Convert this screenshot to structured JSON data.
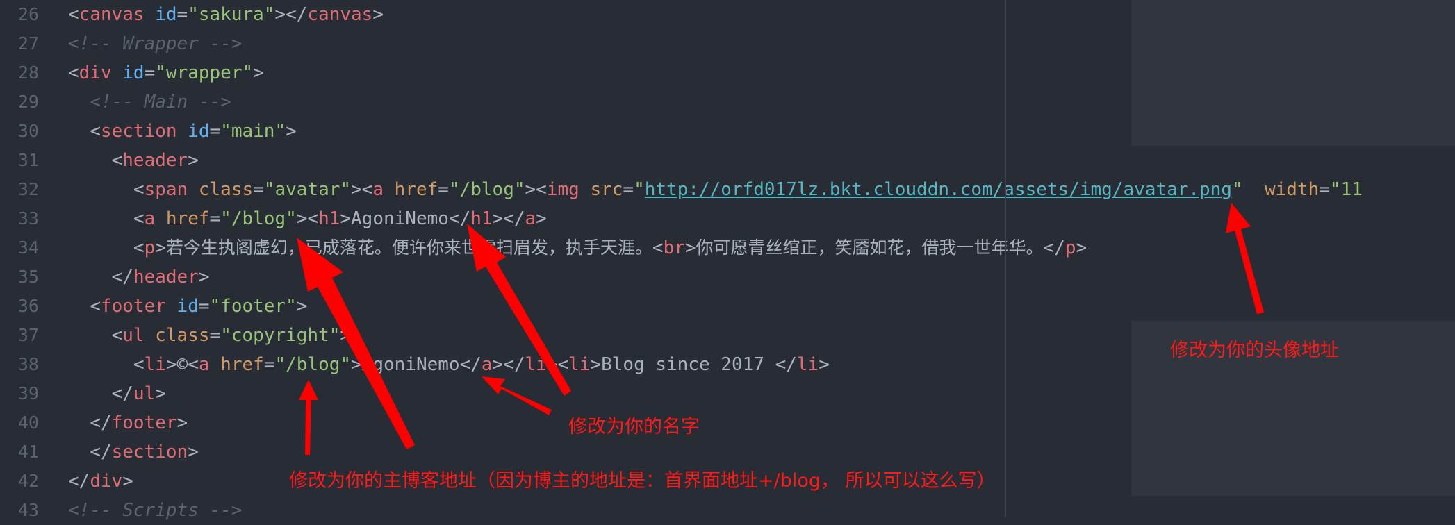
{
  "editor": {
    "lines": [
      {
        "n": "26",
        "indent": "",
        "parts": [
          [
            "punc",
            "<"
          ],
          [
            "tag",
            "canvas"
          ],
          [
            "punc",
            " "
          ],
          [
            "attr-id",
            "id"
          ],
          [
            "punc",
            "="
          ],
          [
            "str",
            "\"sakura\""
          ],
          [
            "punc",
            "></"
          ],
          [
            "tag",
            "canvas"
          ],
          [
            "punc",
            ">"
          ]
        ]
      },
      {
        "n": "27",
        "indent": "",
        "parts": [
          [
            "cmt",
            "<!-- Wrapper -->"
          ]
        ]
      },
      {
        "n": "28",
        "indent": "",
        "parts": [
          [
            "punc",
            "<"
          ],
          [
            "tag",
            "div"
          ],
          [
            "punc",
            " "
          ],
          [
            "attr-id",
            "id"
          ],
          [
            "punc",
            "="
          ],
          [
            "str",
            "\"wrapper\""
          ],
          [
            "punc",
            ">"
          ]
        ]
      },
      {
        "n": "29",
        "indent": "  ",
        "parts": [
          [
            "cmt",
            "<!-- Main -->"
          ]
        ]
      },
      {
        "n": "30",
        "indent": "  ",
        "parts": [
          [
            "punc",
            "<"
          ],
          [
            "tag",
            "section"
          ],
          [
            "punc",
            " "
          ],
          [
            "attr-id",
            "id"
          ],
          [
            "punc",
            "="
          ],
          [
            "str",
            "\"main\""
          ],
          [
            "punc",
            ">"
          ]
        ]
      },
      {
        "n": "31",
        "indent": "    ",
        "parts": [
          [
            "punc",
            "<"
          ],
          [
            "tag",
            "header"
          ],
          [
            "punc",
            ">"
          ]
        ]
      },
      {
        "n": "32",
        "indent": "      ",
        "parts": [
          [
            "punc",
            "<"
          ],
          [
            "tag",
            "span"
          ],
          [
            "punc",
            " "
          ],
          [
            "attr",
            "class"
          ],
          [
            "punc",
            "="
          ],
          [
            "str",
            "\"avatar\""
          ],
          [
            "punc",
            "><"
          ],
          [
            "tag",
            "a"
          ],
          [
            "punc",
            " "
          ],
          [
            "attr",
            "href"
          ],
          [
            "punc",
            "="
          ],
          [
            "str",
            "\"/blog\""
          ],
          [
            "punc",
            "><"
          ],
          [
            "tag",
            "img"
          ],
          [
            "punc",
            " "
          ],
          [
            "attr",
            "src"
          ],
          [
            "punc",
            "="
          ],
          [
            "str",
            "\""
          ],
          [
            "url",
            "http://orfd017lz.bkt.clouddn.com/assets/img/avatar.png"
          ],
          [
            "str",
            "\""
          ],
          [
            "punc",
            "  "
          ],
          [
            "attr",
            "width"
          ],
          [
            "punc",
            "="
          ],
          [
            "str",
            "\"11"
          ]
        ]
      },
      {
        "n": "33",
        "indent": "      ",
        "parts": [
          [
            "punc",
            "<"
          ],
          [
            "tag",
            "a"
          ],
          [
            "punc",
            " "
          ],
          [
            "attr",
            "href"
          ],
          [
            "punc",
            "="
          ],
          [
            "str",
            "\"/blog\""
          ],
          [
            "punc",
            "><"
          ],
          [
            "tag",
            "h1"
          ],
          [
            "punc",
            ">"
          ],
          [
            "txt",
            "AgoniNemo"
          ],
          [
            "punc",
            "</"
          ],
          [
            "tag",
            "h1"
          ],
          [
            "punc",
            "></"
          ],
          [
            "tag",
            "a"
          ],
          [
            "punc",
            ">"
          ]
        ]
      },
      {
        "n": "34",
        "indent": "      ",
        "parts": [
          [
            "punc",
            "<"
          ],
          [
            "tag",
            "p"
          ],
          [
            "punc",
            ">"
          ],
          [
            "txt cjk",
            "若今生执阁虚幻，已成落花。便许你来世雪扫眉发，执手天涯。"
          ],
          [
            "punc",
            "<"
          ],
          [
            "tag",
            "br"
          ],
          [
            "punc",
            ">"
          ],
          [
            "txt cjk",
            "你可愿青丝绾正，笑靥如花，借我一世年华。"
          ],
          [
            "punc",
            "</"
          ],
          [
            "tag",
            "p"
          ],
          [
            "punc",
            ">"
          ]
        ]
      },
      {
        "n": "35",
        "indent": "    ",
        "parts": [
          [
            "punc",
            "</"
          ],
          [
            "tag",
            "header"
          ],
          [
            "punc",
            ">"
          ]
        ]
      },
      {
        "n": "36",
        "indent": "  ",
        "parts": [
          [
            "punc",
            "<"
          ],
          [
            "tag",
            "footer"
          ],
          [
            "punc",
            " "
          ],
          [
            "attr-id",
            "id"
          ],
          [
            "punc",
            "="
          ],
          [
            "str",
            "\"footer\""
          ],
          [
            "punc",
            ">"
          ]
        ]
      },
      {
        "n": "37",
        "indent": "    ",
        "parts": [
          [
            "punc",
            "<"
          ],
          [
            "tag",
            "ul"
          ],
          [
            "punc",
            " "
          ],
          [
            "attr",
            "class"
          ],
          [
            "punc",
            "="
          ],
          [
            "str",
            "\"copyright\""
          ],
          [
            "punc",
            ">"
          ]
        ]
      },
      {
        "n": "38",
        "indent": "      ",
        "parts": [
          [
            "punc",
            "<"
          ],
          [
            "tag",
            "li"
          ],
          [
            "punc",
            ">©<"
          ],
          [
            "tag",
            "a"
          ],
          [
            "punc",
            " "
          ],
          [
            "attr",
            "href"
          ],
          [
            "punc",
            "="
          ],
          [
            "str",
            "\"/blog\""
          ],
          [
            "punc",
            ">"
          ],
          [
            "txt",
            "AgoniNemo"
          ],
          [
            "punc",
            "</"
          ],
          [
            "tag",
            "a"
          ],
          [
            "punc",
            "></"
          ],
          [
            "tag",
            "li"
          ],
          [
            "punc",
            "><"
          ],
          [
            "tag",
            "li"
          ],
          [
            "punc",
            ">"
          ],
          [
            "txt",
            "Blog since 2017 "
          ],
          [
            "punc",
            "</"
          ],
          [
            "tag",
            "li"
          ],
          [
            "punc",
            ">"
          ]
        ]
      },
      {
        "n": "39",
        "indent": "    ",
        "parts": [
          [
            "punc",
            "</"
          ],
          [
            "tag",
            "ul"
          ],
          [
            "punc",
            ">"
          ]
        ]
      },
      {
        "n": "40",
        "indent": "  ",
        "parts": [
          [
            "punc",
            "</"
          ],
          [
            "tag",
            "footer"
          ],
          [
            "punc",
            ">"
          ]
        ]
      },
      {
        "n": "41",
        "indent": "  ",
        "parts": [
          [
            "punc",
            "</"
          ],
          [
            "tag",
            "section"
          ],
          [
            "punc",
            ">"
          ]
        ]
      },
      {
        "n": "42",
        "indent": "",
        "parts": [
          [
            "punc",
            "</"
          ],
          [
            "tag",
            "div"
          ],
          [
            "punc",
            ">"
          ]
        ]
      },
      {
        "n": "43",
        "indent": "",
        "parts": [
          [
            "cmt",
            "<!-- Scripts -->"
          ]
        ]
      }
    ]
  },
  "annotations": {
    "avatar": "修改为你的头像地址",
    "name": "修改为你的名字",
    "blog": "修改为你的主博客地址（因为博主的地址是：首界面地址+/blog， 所以可以这么写）"
  },
  "colors": {
    "background": "#282c34",
    "tag": "#e06c75",
    "attribute": "#d19a66",
    "id_attribute": "#61afef",
    "string": "#98c379",
    "url": "#56b6c2",
    "comment": "#5c6370",
    "annotation": "#ff1a1a"
  }
}
